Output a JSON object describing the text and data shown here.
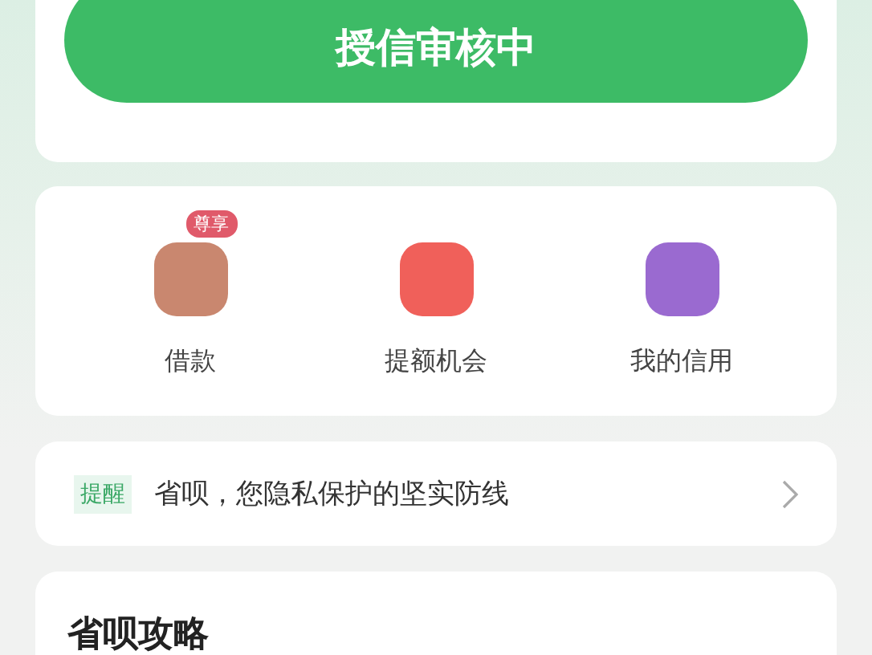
{
  "status_button": {
    "label": "授信审核中"
  },
  "shortcuts": [
    {
      "label": "借款",
      "badge": "尊享",
      "color": "#c9876f"
    },
    {
      "label": "提额机会",
      "color": "#f0605a"
    },
    {
      "label": "我的信用",
      "color": "#9a6ad0"
    }
  ],
  "notice": {
    "tag": "提醒",
    "text": "省呗，您隐私保护的坚实防线"
  },
  "guide": {
    "title": "省呗攻略"
  }
}
